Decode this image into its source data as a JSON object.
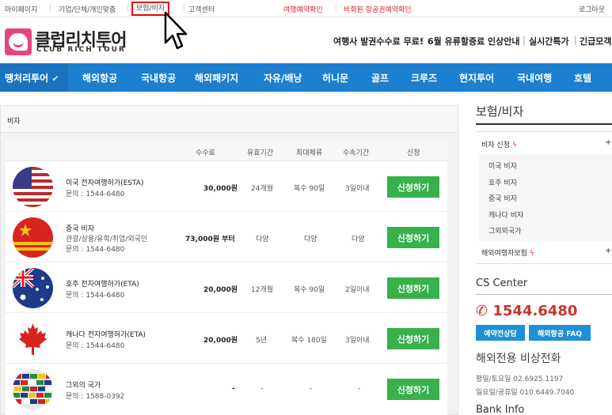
{
  "topbar": {
    "links": [
      "마이페이지",
      "기업/단체/개인맞춤",
      "보험/비자",
      "고객센터"
    ],
    "red_links": [
      "여행예약확인",
      "비회원 항공권예약확인"
    ],
    "logout": "로그아웃"
  },
  "logo": {
    "name_ko": "클럽리치투어",
    "name_en": "CLUB RICH TOUR"
  },
  "promos": [
    "여행사 발권수수료 무료!",
    "6월 유류할증료 인상안내",
    "실시간특가",
    "긴급모객"
  ],
  "nav": {
    "first": "땡처리투어",
    "items": [
      "해외항공",
      "국내항공",
      "해외패키지",
      "자유/배낭",
      "허니문",
      "골프",
      "크루즈",
      "현지투어",
      "국내여행",
      "호텔"
    ]
  },
  "main": {
    "section_label": "비자",
    "headers": [
      "수수료",
      "유효기간",
      "최대체류",
      "수속기간",
      "신청"
    ],
    "rows": [
      {
        "name": "미국 전자여행허가(ESTA)",
        "desc": "",
        "phone": "문의 : 1544-6480",
        "fee": "30,000원",
        "valid": "24개월",
        "stay": "복수 90일",
        "process": "3일이내",
        "button": "신청하기",
        "flag": "us-flag-icon"
      },
      {
        "name": "중국 비자",
        "desc": "관광/상용/유학/취업/외국인",
        "phone": "문의 : 1544-6480",
        "fee": "73,000원 부터",
        "valid": "다양",
        "stay": "다양",
        "process": "다양",
        "button": "신청하기",
        "flag": "china-flag-icon"
      },
      {
        "name": "호주 전자여행허가(ETA)",
        "desc": "",
        "phone": "문의 : 1544-6480",
        "fee": "20,000원",
        "valid": "12개월",
        "stay": "복수 90일",
        "process": "2일이내",
        "button": "신청하기",
        "flag": "australia-flag-icon"
      },
      {
        "name": "캐나다 전자여행허가(ETA)",
        "desc": "",
        "phone": "문의 : 1544-6480",
        "fee": "20,000원",
        "valid": "5년",
        "stay": "복수 180일",
        "process": "3일이내",
        "button": "신청하기",
        "flag": "canada-flag-icon"
      },
      {
        "name": "그외의 국가",
        "desc": "",
        "phone": "문의 : 1588-0392",
        "fee": "-",
        "valid": "-",
        "stay": "-",
        "process": "-",
        "button": "신청하기",
        "flag": "world-flags-icon"
      }
    ]
  },
  "sidebar": {
    "title": "보험/비자",
    "visa_category": "비자 신청",
    "visa_items": [
      "미국 비자",
      "호주 비자",
      "중국 비자",
      "캐나다 비자",
      "그외외국가"
    ],
    "insurance_category": "해외여행자보험",
    "plus": "+"
  },
  "cs": {
    "title": "CS Center",
    "phone": "1544.6480",
    "btn_consult": "예약전상담",
    "btn_faq": "해외항공 FAQ",
    "emergency_title": "해외전용 비상전화",
    "line1": "평일/토요일 02.6925.1197",
    "line2": "일요일/공휴일 010.6449.7040",
    "bank": "Bank Info"
  },
  "colors": {
    "nav_blue": "#1c7fcf",
    "apply_green": "#37b14b",
    "phone_red": "#c8342c",
    "brand_pink": "#e6457c"
  }
}
